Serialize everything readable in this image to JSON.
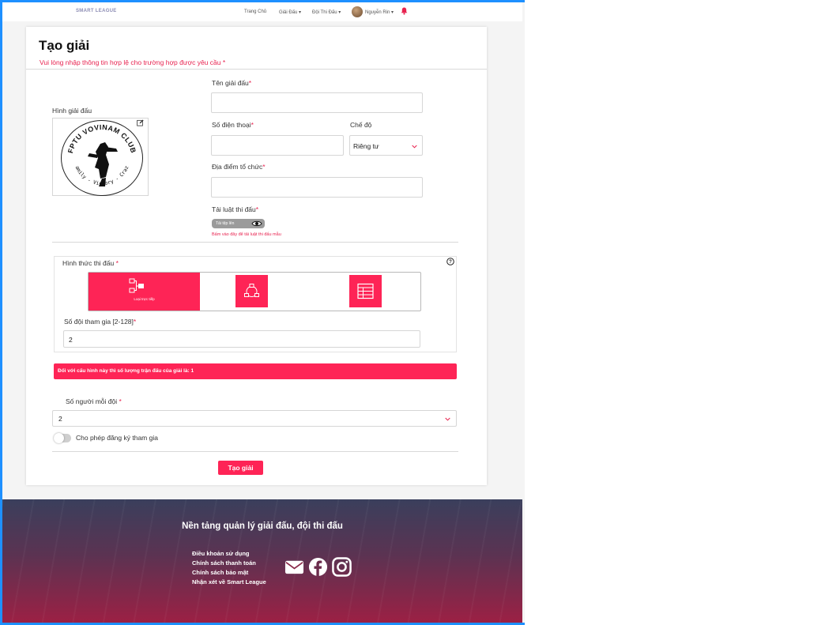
{
  "navbar": {
    "brand": "SMART LEAGUE",
    "links": [
      "Trang Chủ",
      "Giải Đấu ▾",
      "Đội Thi Đấu ▾"
    ],
    "user_name": "Nguyễn Rin ▾"
  },
  "form": {
    "title": "Tạo giải",
    "subtitle": "Vui lòng nhập thông tin hợp lệ cho trường hợp được yêu cầu *",
    "image_label": "Hình giải đấu",
    "logo_text_top": "FPTU VOVINAM CLUB",
    "logo_text_bottom": "Family - Victory - Crazy",
    "tournament_name_label": "Tên giải đấu",
    "tournament_name_value": "",
    "phone_label": "Số điện thoại",
    "phone_value": "",
    "mode_label": "Chế độ",
    "mode_value": "Riêng tư",
    "location_label": "Địa điểm tổ chức",
    "location_value": "",
    "rules_label": "Tải luật thi đấu",
    "upload_label": "Tải tệp lên",
    "upload_hint": "Bấm vào đây để tải luật thi đấu mẫu",
    "required_mark": "*",
    "format_label": "Hình thức thi đấu",
    "format_options": [
      {
        "label": "Loại trực tiếp",
        "icon": "bracket-icon",
        "selected": true
      },
      {
        "label": "",
        "icon": "round-robin-icon",
        "selected": false
      },
      {
        "label": "",
        "icon": "table-icon",
        "selected": false
      }
    ],
    "teams_label": "Số đội tham gia [2-128]",
    "teams_value": "2",
    "alert_text": "Đối với cấu hình này thì số lượng trận đấu của giải là: 1",
    "players_label": "Số người mỗi đội",
    "players_value": "2",
    "allow_register_label": "Cho phép đăng ký tham gia",
    "allow_register_on": false,
    "submit_label": "Tạo giải"
  },
  "footer": {
    "title": "Nền tảng quản lý giải đấu, đội thi đấu",
    "links": [
      "Điều khoản sử dụng",
      "Chính sách thanh toán",
      "Chính sách bảo mật",
      "Nhận xét về Smart League"
    ],
    "icons": [
      "mail-icon",
      "facebook-icon",
      "instagram-icon"
    ]
  },
  "colors": {
    "accent": "#fe2456",
    "brand": "#8e8eb5",
    "frame": "#1e90ff"
  }
}
